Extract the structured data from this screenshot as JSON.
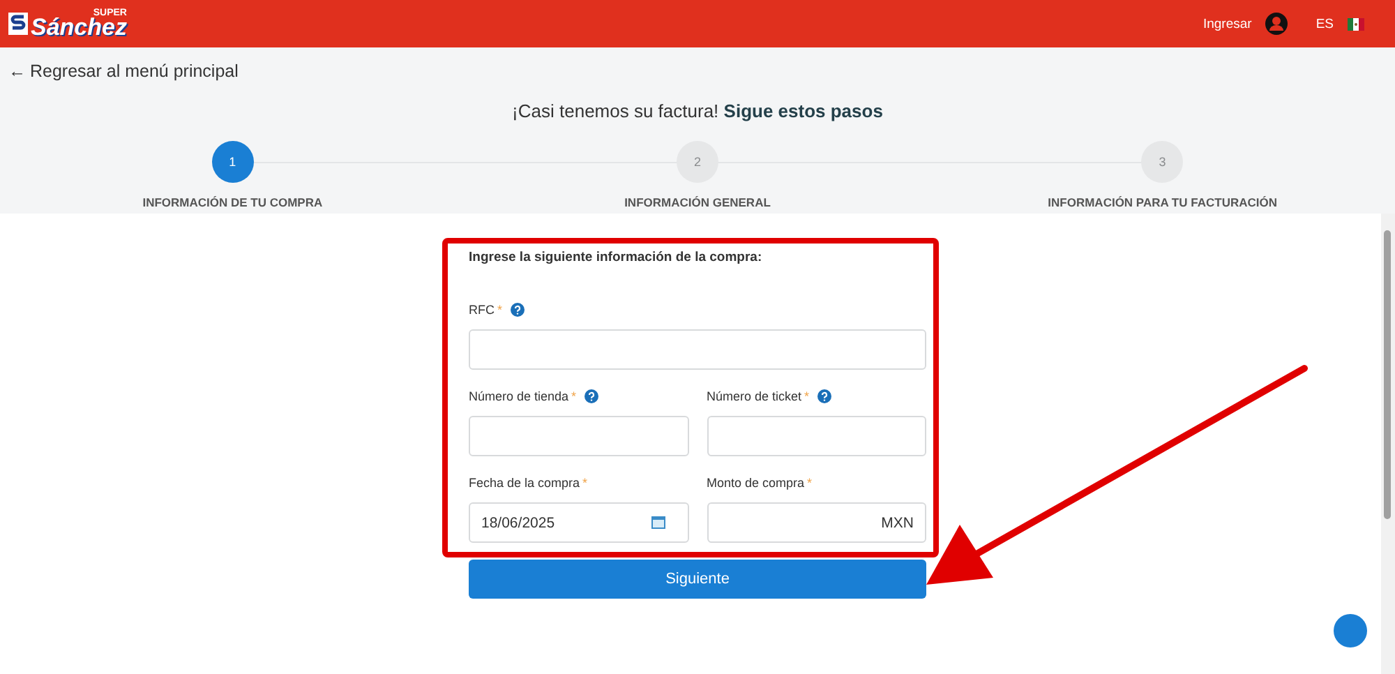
{
  "header": {
    "logo": {
      "small": "SUPER",
      "name": "Sánchez"
    },
    "login": "Ingresar",
    "language": "ES"
  },
  "back_link": {
    "icon": "←",
    "label": "Regresar al menú principal"
  },
  "title": "¡Casi tenemos su factura! **Sigue estos pasos**",
  "steps": [
    {
      "number": "1",
      "label": "INFORMACIÓN DE TU COMPRA",
      "selected": true
    },
    {
      "number": "2",
      "label": "INFORMACIÓN GENERAL",
      "selected": false
    },
    {
      "number": "3",
      "label": "INFORMACIÓN PARA TU FACTURACIÓN",
      "selected": false
    }
  ],
  "form": {
    "heading": "Ingrese la siguiente información de la compra:",
    "rows": [
      [
        {
          "label": "RFC",
          "mark": "*",
          "help": true
        }
      ],
      [
        {
          "label": "Número de tienda",
          "mark": "*",
          "help": true
        },
        {
          "label": "Número de ticket",
          "mark": "*",
          "help": true
        }
      ],
      [
        {
          "label": "Fecha de la compra",
          "mark": "*",
          "help": false,
          "value": "18/06/2025",
          "kind": "date"
        },
        {
          "label": "Monto de compra",
          "mark": "*",
          "help": false,
          "suffix": "MXN",
          "kind": "amount"
        }
      ]
    ],
    "button": "Siguiente"
  }
}
